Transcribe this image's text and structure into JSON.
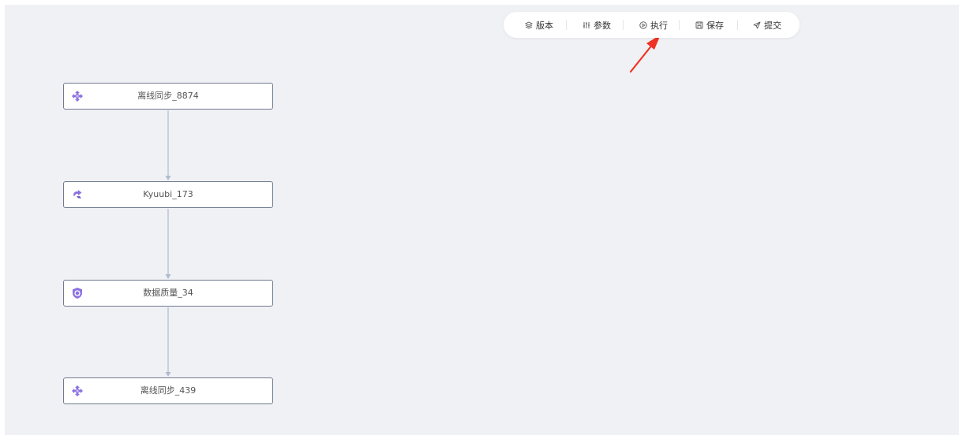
{
  "toolbar": {
    "version": {
      "label": "版本",
      "icon": "layers-icon"
    },
    "params": {
      "label": "参数",
      "icon": "sliders-icon"
    },
    "run": {
      "label": "执行",
      "icon": "play-circle-icon"
    },
    "save": {
      "label": "保存",
      "icon": "save-icon"
    },
    "submit": {
      "label": "提交",
      "icon": "send-icon"
    }
  },
  "nodes": [
    {
      "label": "离线同步_8874",
      "icon": "offline-sync-icon"
    },
    {
      "label": "Kyuubi_173",
      "icon": "kyuubi-icon"
    },
    {
      "label": "数据质量_34",
      "icon": "data-quality-shield-icon"
    },
    {
      "label": "离线同步_439",
      "icon": "offline-sync-icon"
    }
  ],
  "colors": {
    "canvas_bg": "#f0f1f4",
    "node_border": "#6f7a8f",
    "edge": "#aebbd0",
    "node_icon": "#8b72e0",
    "annotation_arrow": "#ee3324"
  }
}
